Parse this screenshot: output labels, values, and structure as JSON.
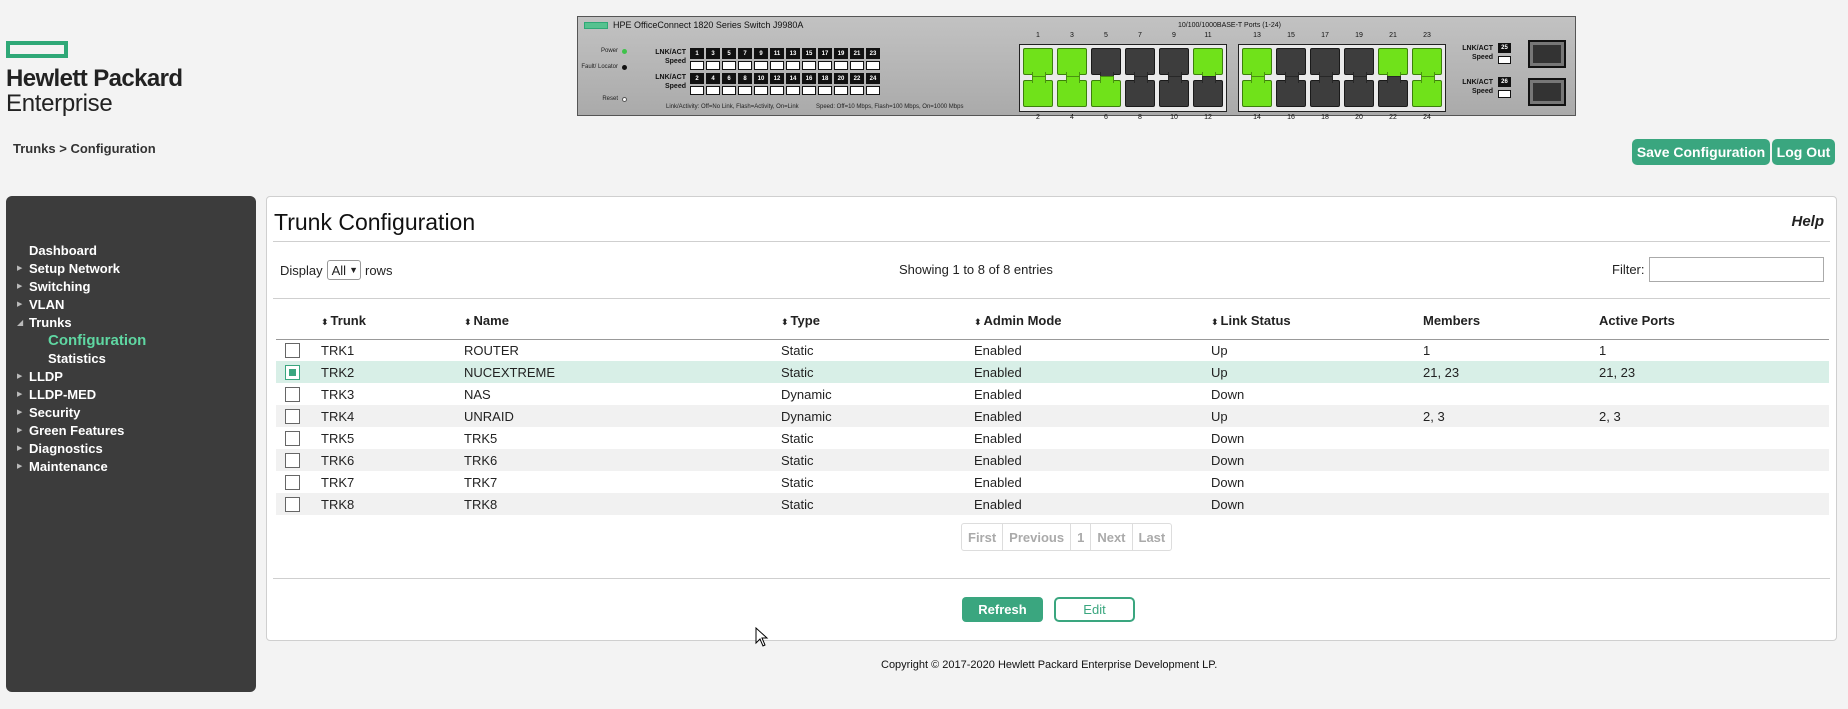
{
  "logo": {
    "line1": "Hewlett Packard",
    "line2": "Enterprise",
    "color": "#2fa877"
  },
  "switch_panel": {
    "model": "HPE OfficeConnect 1820 Series Switch J9980A",
    "ports_title": "10/100/1000BASE-T Ports (1-24)",
    "leds": {
      "power": "Power",
      "fault": "Fault/ Locator",
      "reset": "Reset"
    },
    "lnk_act": "LNK/ACT",
    "speed": "Speed",
    "mini_top": [
      "1",
      "3",
      "5",
      "7",
      "9",
      "11",
      "13",
      "15",
      "17",
      "19",
      "21",
      "23"
    ],
    "mini_bottom": [
      "2",
      "4",
      "6",
      "8",
      "10",
      "12",
      "14",
      "16",
      "18",
      "20",
      "22",
      "24"
    ],
    "legend_link": "Link/Activity: Off=No Link, Flash=Activity, On=Link",
    "legend_speed": "Speed: Off=10 Mbps, Flash=100 Mbps, On=1000 Mbps",
    "top_numbers": [
      "1",
      "3",
      "5",
      "7",
      "9",
      "11",
      "13",
      "15",
      "17",
      "19",
      "21",
      "23"
    ],
    "bottom_numbers": [
      "2",
      "4",
      "6",
      "8",
      "10",
      "12",
      "14",
      "16",
      "18",
      "20",
      "22",
      "24"
    ],
    "ports_up": [
      "1",
      "2",
      "3",
      "11",
      "13",
      "21",
      "23",
      "4",
      "6",
      "14",
      "24"
    ],
    "sfp_ports": [
      "25",
      "26"
    ],
    "active_color": "#70e21a"
  },
  "breadcrumb": "Trunks > Configuration",
  "header_buttons": {
    "save": "Save Configuration",
    "logout": "Log Out"
  },
  "sidebar": {
    "items": [
      {
        "label": "Dashboard",
        "arrow": ""
      },
      {
        "label": "Setup Network",
        "arrow": "right"
      },
      {
        "label": "Switching",
        "arrow": "right"
      },
      {
        "label": "VLAN",
        "arrow": "right"
      },
      {
        "label": "Trunks",
        "arrow": "down"
      },
      {
        "label": "LLDP",
        "arrow": "right"
      },
      {
        "label": "LLDP-MED",
        "arrow": "right"
      },
      {
        "label": "Security",
        "arrow": "right"
      },
      {
        "label": "Green Features",
        "arrow": "right"
      },
      {
        "label": "Diagnostics",
        "arrow": "right"
      },
      {
        "label": "Maintenance",
        "arrow": "right"
      }
    ],
    "trunks_sub": [
      "Configuration",
      "Statistics"
    ],
    "active_sub": "Configuration"
  },
  "main": {
    "title": "Trunk Configuration",
    "help": "Help",
    "display_label": "Display",
    "display_value": "All",
    "rows_label": "rows",
    "showing": "Showing 1 to 8 of 8 entries",
    "filter_label": "Filter:",
    "columns": [
      "Trunk",
      "Name",
      "Type",
      "Admin Mode",
      "Link Status",
      "Members",
      "Active Ports"
    ],
    "rows": [
      {
        "trunk": "TRK1",
        "name": "ROUTER",
        "type": "Static",
        "admin": "Enabled",
        "link": "Up",
        "members": "1",
        "active": "1",
        "selected": false
      },
      {
        "trunk": "TRK2",
        "name": "NUCEXTREME",
        "type": "Static",
        "admin": "Enabled",
        "link": "Up",
        "members": "21, 23",
        "active": "21, 23",
        "selected": true
      },
      {
        "trunk": "TRK3",
        "name": "NAS",
        "type": "Dynamic",
        "admin": "Enabled",
        "link": "Down",
        "members": "",
        "active": "",
        "selected": false
      },
      {
        "trunk": "TRK4",
        "name": "UNRAID",
        "type": "Dynamic",
        "admin": "Enabled",
        "link": "Up",
        "members": "2, 3",
        "active": "2, 3",
        "selected": false
      },
      {
        "trunk": "TRK5",
        "name": "TRK5",
        "type": "Static",
        "admin": "Enabled",
        "link": "Down",
        "members": "",
        "active": "",
        "selected": false
      },
      {
        "trunk": "TRK6",
        "name": "TRK6",
        "type": "Static",
        "admin": "Enabled",
        "link": "Down",
        "members": "",
        "active": "",
        "selected": false
      },
      {
        "trunk": "TRK7",
        "name": "TRK7",
        "type": "Static",
        "admin": "Enabled",
        "link": "Down",
        "members": "",
        "active": "",
        "selected": false
      },
      {
        "trunk": "TRK8",
        "name": "TRK8",
        "type": "Static",
        "admin": "Enabled",
        "link": "Down",
        "members": "",
        "active": "",
        "selected": false
      }
    ],
    "pager": [
      "First",
      "Previous",
      "1",
      "Next",
      "Last"
    ],
    "refresh": "Refresh",
    "edit": "Edit"
  },
  "copyright": "Copyright © 2017-2020 Hewlett Packard Enterprise Development LP.",
  "accent_color": "#3aa67f"
}
